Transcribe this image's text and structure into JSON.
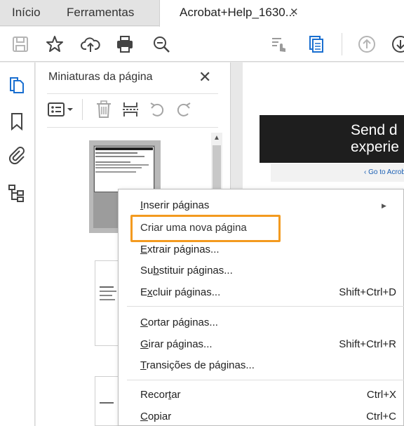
{
  "tabs": {
    "home": "Início",
    "tools": "Ferramentas",
    "document": "Acrobat+Help_1630...",
    "close": "✕"
  },
  "toolbar": {
    "icons": [
      "save-icon",
      "star-icon",
      "cloud-upload-icon",
      "print-icon",
      "zoom-out-icon",
      "hand-sign-icon",
      "organize-pages-icon",
      "page-up-icon",
      "page-down-icon"
    ]
  },
  "rail": {
    "icons": [
      "pages-icon",
      "bookmark-icon",
      "attachment-icon",
      "tree-icon"
    ]
  },
  "panel": {
    "title": "Miniaturas da página",
    "close": "✕"
  },
  "document": {
    "banner_line1": "Send d",
    "banner_line2": "experie",
    "goto_link": "‹  Go to Acrobat I"
  },
  "context_menu": {
    "items": [
      {
        "pre": "",
        "u": "I",
        "post": "nserir páginas",
        "shortcut": "",
        "submenu": true
      },
      {
        "pre": "Criar uma nova página",
        "u": "",
        "post": "",
        "shortcut": ""
      },
      {
        "pre": "",
        "u": "E",
        "post": "xtrair páginas...",
        "shortcut": ""
      },
      {
        "pre": "Su",
        "u": "b",
        "post": "stituir páginas...",
        "shortcut": ""
      },
      {
        "pre": "E",
        "u": "x",
        "post": "cluir páginas...",
        "shortcut": "Shift+Ctrl+D"
      },
      {
        "pre": "",
        "u": "C",
        "post": "ortar páginas...",
        "shortcut": ""
      },
      {
        "pre": "",
        "u": "G",
        "post": "irar páginas...",
        "shortcut": "Shift+Ctrl+R"
      },
      {
        "pre": "",
        "u": "T",
        "post": "ransições de páginas...",
        "shortcut": ""
      },
      {
        "pre": "Recor",
        "u": "t",
        "post": "ar",
        "shortcut": "Ctrl+X"
      },
      {
        "pre": "",
        "u": "C",
        "post": "opiar",
        "shortcut": "Ctrl+C"
      }
    ],
    "submenu_arrow": "▶",
    "highlight_color": "#f39a1f"
  }
}
